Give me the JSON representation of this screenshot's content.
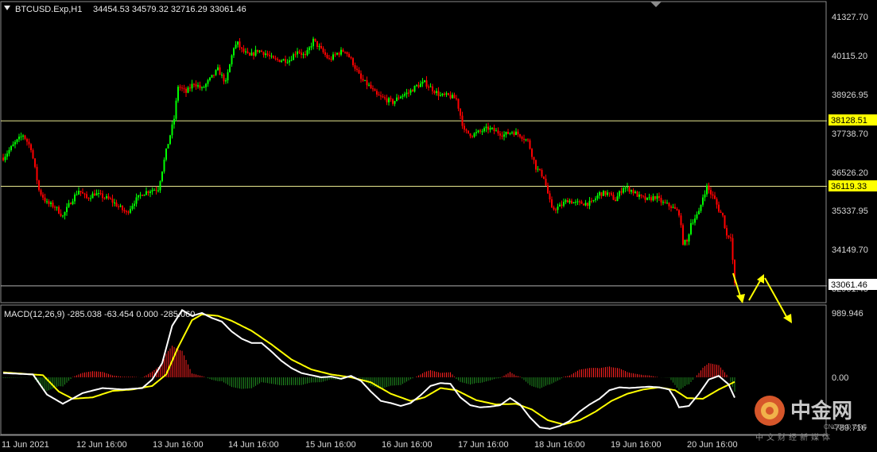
{
  "header": {
    "symbol": "BTCUSD.Exp,H1",
    "ohlc": "34454.53 34579.32 32716.29 33061.46"
  },
  "macd_header": "MACD(12,26,9) -285.038 -63.454 0.000 -285.060",
  "price_axis": {
    "min": 32716.29,
    "max": 41500,
    "ticks": [
      "41327.70",
      "40115.20",
      "38926.95",
      "37738.70",
      "36526.20",
      "35337.95",
      "34149.70",
      "32961.45"
    ]
  },
  "macd_axis": {
    "ticks": [
      "989.946",
      "0.00",
      "-789.716"
    ]
  },
  "x_labels": [
    "11 Jun 2021",
    "12 Jun 16:00",
    "13 Jun 16:00",
    "14 Jun 16:00",
    "15 Jun 16:00",
    "16 Jun 16:00",
    "17 Jun 16:00",
    "18 Jun 16:00",
    "19 Jun 16:00",
    "20 Jun 16:00"
  ],
  "levels": [
    {
      "value": "38128.51",
      "color": "#e8e890",
      "label_bg": "#ffff00"
    },
    {
      "value": "36119.33",
      "color": "#e8e890",
      "label_bg": "#ffff00"
    },
    {
      "value": "33061.46",
      "color": "#b0b0b0",
      "label_bg": "#ffffff"
    }
  ],
  "colors": {
    "bull": "#00ff00",
    "bear": "#ff0000",
    "macd_line": "#ffffff",
    "signal_line": "#ffff00",
    "hist_pos": "#ff2020",
    "hist_neg": "#1f8a1f",
    "arrow": "#ffff00"
  },
  "watermark": {
    "brand": "中金网",
    "url": "CNGOLD.ORG",
    "subtitle": "中文财经新媒体"
  },
  "chart_data": {
    "type": "candlestick",
    "timeframe": "H1",
    "price_path": [
      [
        0,
        37000
      ],
      [
        6,
        37450
      ],
      [
        10,
        37700
      ],
      [
        14,
        37300
      ],
      [
        18,
        36000
      ],
      [
        22,
        35600
      ],
      [
        26,
        35500
      ],
      [
        30,
        35200
      ],
      [
        34,
        35650
      ],
      [
        38,
        36000
      ],
      [
        42,
        35750
      ],
      [
        46,
        35900
      ],
      [
        50,
        35800
      ],
      [
        54,
        35700
      ],
      [
        58,
        35500
      ],
      [
        62,
        35300
      ],
      [
        66,
        35650
      ],
      [
        70,
        35900
      ],
      [
        74,
        36000
      ],
      [
        78,
        36050
      ],
      [
        82,
        37200
      ],
      [
        86,
        38200
      ],
      [
        88,
        39200
      ],
      [
        92,
        39000
      ],
      [
        96,
        39300
      ],
      [
        100,
        39100
      ],
      [
        104,
        39400
      ],
      [
        108,
        39700
      ],
      [
        112,
        39300
      ],
      [
        116,
        40400
      ],
      [
        118,
        40500
      ],
      [
        120,
        40300
      ],
      [
        124,
        40100
      ],
      [
        128,
        40300
      ],
      [
        132,
        40200
      ],
      [
        136,
        40000
      ],
      [
        140,
        40000
      ],
      [
        144,
        40000
      ],
      [
        148,
        40300
      ],
      [
        152,
        40100
      ],
      [
        156,
        40600
      ],
      [
        160,
        40300
      ],
      [
        164,
        40000
      ],
      [
        168,
        40200
      ],
      [
        172,
        40300
      ],
      [
        176,
        39900
      ],
      [
        180,
        39400
      ],
      [
        184,
        39200
      ],
      [
        188,
        38900
      ],
      [
        192,
        38800
      ],
      [
        196,
        38700
      ],
      [
        200,
        38900
      ],
      [
        204,
        39000
      ],
      [
        208,
        39200
      ],
      [
        212,
        39300
      ],
      [
        216,
        39100
      ],
      [
        220,
        38900
      ],
      [
        224,
        38900
      ],
      [
        228,
        38800
      ],
      [
        232,
        37800
      ],
      [
        236,
        37700
      ],
      [
        240,
        37800
      ],
      [
        244,
        37900
      ],
      [
        248,
        37800
      ],
      [
        252,
        37700
      ],
      [
        256,
        37800
      ],
      [
        260,
        37700
      ],
      [
        264,
        37500
      ],
      [
        268,
        36700
      ],
      [
        272,
        36400
      ],
      [
        276,
        35400
      ],
      [
        280,
        35500
      ],
      [
        284,
        35700
      ],
      [
        288,
        35600
      ],
      [
        292,
        35600
      ],
      [
        296,
        35600
      ],
      [
        300,
        35900
      ],
      [
        304,
        35900
      ],
      [
        308,
        35700
      ],
      [
        312,
        36100
      ],
      [
        316,
        36000
      ],
      [
        320,
        35800
      ],
      [
        324,
        35700
      ],
      [
        328,
        35800
      ],
      [
        332,
        35600
      ],
      [
        336,
        35500
      ],
      [
        340,
        35300
      ],
      [
        342,
        34400
      ],
      [
        344,
        34400
      ],
      [
        346,
        35000
      ],
      [
        350,
        35300
      ],
      [
        352,
        35800
      ],
      [
        354,
        36100
      ],
      [
        356,
        35900
      ],
      [
        358,
        35700
      ],
      [
        360,
        35400
      ],
      [
        362,
        35200
      ],
      [
        364,
        34600
      ],
      [
        366,
        34600
      ],
      [
        368,
        33100
      ]
    ],
    "levels": [
      38128.51,
      36119.33,
      33061.46
    ],
    "macd": {
      "params": "12,26,9",
      "values": [
        -285.038,
        -63.454,
        0.0,
        -285.06
      ],
      "macd_path": [
        [
          0,
          60
        ],
        [
          15,
          40
        ],
        [
          22,
          -240
        ],
        [
          30,
          -370
        ],
        [
          40,
          -220
        ],
        [
          50,
          -150
        ],
        [
          60,
          -170
        ],
        [
          70,
          -150
        ],
        [
          75,
          -30
        ],
        [
          80,
          200
        ],
        [
          85,
          720
        ],
        [
          90,
          940
        ],
        [
          95,
          860
        ],
        [
          100,
          900
        ],
        [
          105,
          830
        ],
        [
          110,
          780
        ],
        [
          115,
          640
        ],
        [
          120,
          540
        ],
        [
          125,
          480
        ],
        [
          130,
          480
        ],
        [
          135,
          360
        ],
        [
          140,
          230
        ],
        [
          145,
          130
        ],
        [
          150,
          60
        ],
        [
          155,
          30
        ],
        [
          160,
          0
        ],
        [
          165,
          10
        ],
        [
          170,
          -20
        ],
        [
          175,
          20
        ],
        [
          180,
          -50
        ],
        [
          185,
          -200
        ],
        [
          190,
          -330
        ],
        [
          195,
          -360
        ],
        [
          200,
          -400
        ],
        [
          205,
          -360
        ],
        [
          210,
          -250
        ],
        [
          215,
          -120
        ],
        [
          220,
          -80
        ],
        [
          225,
          -90
        ],
        [
          230,
          -280
        ],
        [
          235,
          -390
        ],
        [
          240,
          -420
        ],
        [
          245,
          -410
        ],
        [
          250,
          -390
        ],
        [
          255,
          -290
        ],
        [
          260,
          -380
        ],
        [
          265,
          -560
        ],
        [
          270,
          -700
        ],
        [
          275,
          -720
        ],
        [
          280,
          -680
        ],
        [
          285,
          -610
        ],
        [
          290,
          -480
        ],
        [
          295,
          -380
        ],
        [
          300,
          -300
        ],
        [
          305,
          -180
        ],
        [
          310,
          -140
        ],
        [
          315,
          -150
        ],
        [
          320,
          -140
        ],
        [
          325,
          -130
        ],
        [
          330,
          -140
        ],
        [
          335,
          -170
        ],
        [
          338,
          -300
        ],
        [
          340,
          -420
        ],
        [
          345,
          -400
        ],
        [
          350,
          -230
        ],
        [
          355,
          -30
        ],
        [
          360,
          20
        ],
        [
          365,
          -100
        ],
        [
          368,
          -285
        ]
      ],
      "signal_path": [
        [
          0,
          70
        ],
        [
          20,
          30
        ],
        [
          28,
          -200
        ],
        [
          35,
          -300
        ],
        [
          45,
          -280
        ],
        [
          55,
          -190
        ],
        [
          65,
          -170
        ],
        [
          75,
          -120
        ],
        [
          82,
          40
        ],
        [
          88,
          420
        ],
        [
          95,
          800
        ],
        [
          100,
          880
        ],
        [
          108,
          860
        ],
        [
          115,
          790
        ],
        [
          125,
          650
        ],
        [
          135,
          460
        ],
        [
          145,
          250
        ],
        [
          155,
          110
        ],
        [
          165,
          40
        ],
        [
          175,
          0
        ],
        [
          185,
          -70
        ],
        [
          195,
          -230
        ],
        [
          205,
          -330
        ],
        [
          212,
          -280
        ],
        [
          220,
          -150
        ],
        [
          228,
          -180
        ],
        [
          238,
          -320
        ],
        [
          248,
          -380
        ],
        [
          258,
          -370
        ],
        [
          266,
          -450
        ],
        [
          274,
          -600
        ],
        [
          282,
          -660
        ],
        [
          290,
          -600
        ],
        [
          298,
          -480
        ],
        [
          306,
          -330
        ],
        [
          314,
          -230
        ],
        [
          322,
          -170
        ],
        [
          330,
          -140
        ],
        [
          338,
          -180
        ],
        [
          344,
          -290
        ],
        [
          352,
          -300
        ],
        [
          360,
          -170
        ],
        [
          366,
          -90
        ],
        [
          368,
          -63
        ]
      ]
    },
    "x_tick_labels": [
      "11 Jun 2021",
      "12 Jun 16:00",
      "13 Jun 16:00",
      "14 Jun 16:00",
      "15 Jun 16:00",
      "16 Jun 16:00",
      "17 Jun 16:00",
      "18 Jun 16:00",
      "19 Jun 16:00",
      "20 Jun 16:00"
    ],
    "y_tick_labels": [
      "41327.70",
      "40115.20",
      "38926.95",
      "37738.70",
      "36526.20",
      "35337.95",
      "34149.70",
      "32961.45"
    ],
    "forecast_arrows": "down, up, down"
  }
}
